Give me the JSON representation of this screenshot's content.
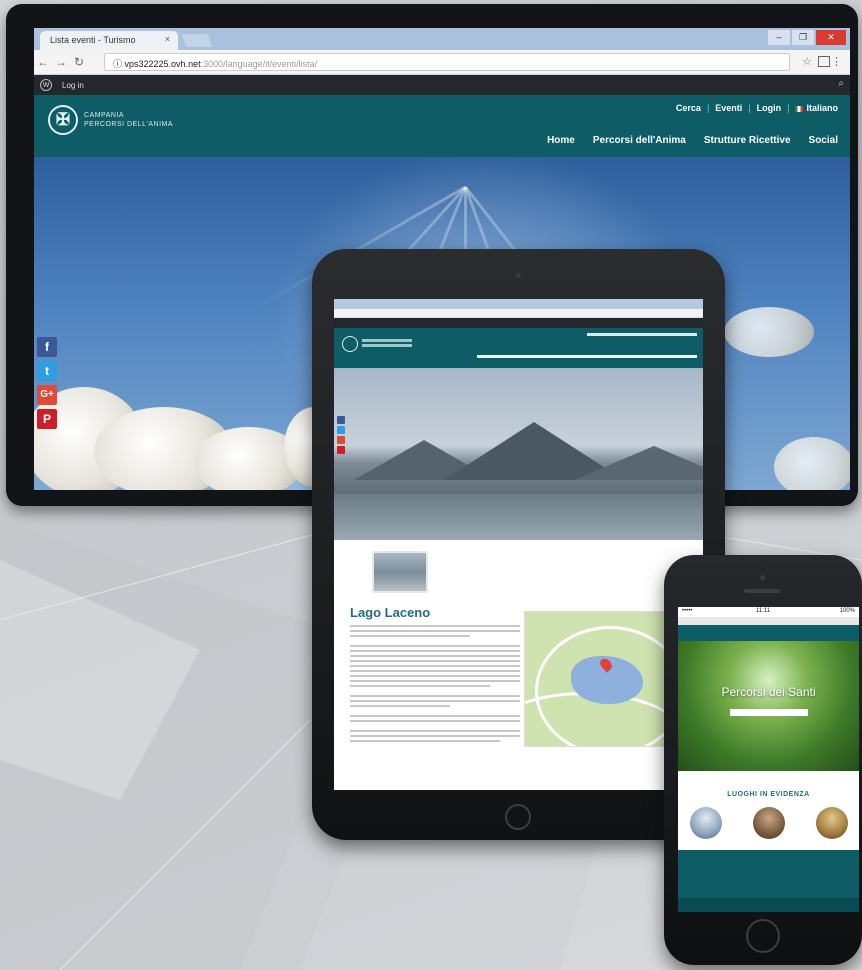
{
  "desktop": {
    "browser": {
      "tab_title": "Lista eventi - Turismo",
      "tab_close": "×",
      "window_minimize": "–",
      "window_maximize": "❐",
      "window_close": "✕",
      "url_host": "vps322225.ovh.net",
      "url_path": ":3000/language/it/eventi/lista/"
    },
    "wp_bar": {
      "login": "Log in"
    },
    "site": {
      "logo_line1": "CAMPANIA",
      "logo_line2": "PERCORSI DELL'ANIMA",
      "top_links": [
        "Cerca",
        "Eventi",
        "Login",
        "Italiano"
      ],
      "nav": [
        "Home",
        "Percorsi dell'Anima",
        "Strutture Ricettive",
        "Social"
      ]
    },
    "social": [
      "f",
      "t",
      "G+",
      "P"
    ]
  },
  "tablet": {
    "page_title": "Lago Laceno"
  },
  "phone": {
    "time": "11:11",
    "battery": "100%",
    "hero_title": "Percorsi dei Santi",
    "section_title": "LUOGHI IN EVIDENZA"
  },
  "colors": {
    "brand_teal": "#0d5c66",
    "facebook": "#3b5998",
    "twitter": "#2d9fe0",
    "google_plus": "#dd4b39",
    "pinterest": "#cb2027"
  }
}
